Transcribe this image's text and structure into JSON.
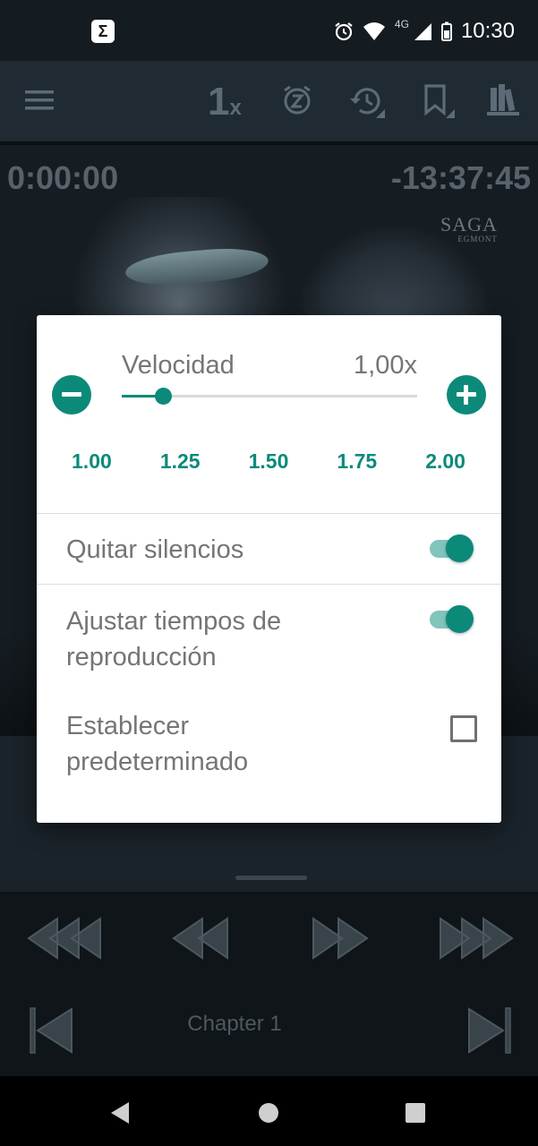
{
  "status_bar": {
    "app_badge": "Σ",
    "network": "4G",
    "time": "10:30"
  },
  "player": {
    "speed_indicator": "1",
    "speed_unit": "x",
    "elapsed": "0:00:00",
    "remaining": "-13:37:45",
    "chapter": "Chapter 1"
  },
  "cover": {
    "publisher_logo": "SAGA",
    "publisher_sub": "EGMONT"
  },
  "speed_dialog": {
    "title": "Velocidad",
    "value": "1,00x",
    "slider_fraction": 0.14,
    "presets": [
      "1.00",
      "1.25",
      "1.50",
      "1.75",
      "2.00"
    ],
    "skip_silence": {
      "label": "Quitar silencios",
      "on": true
    },
    "adjust_times": {
      "label_line1": "Ajustar tiempos de",
      "label_line2": "reproducción",
      "on": true
    },
    "set_default": {
      "label_line1": "Establecer",
      "label_line2": "predeterminado",
      "checked": false
    }
  },
  "colors": {
    "accent": "#0b8a7a",
    "toggle_track": "#80c4bb",
    "toolbar": "#1f2a33"
  }
}
